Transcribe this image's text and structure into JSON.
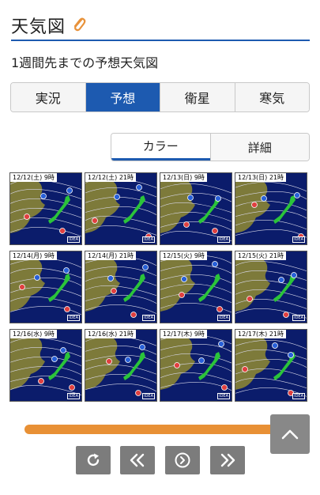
{
  "header": {
    "title": "天気図"
  },
  "subtitle": "1週間先までの予想天気図",
  "tabs": [
    {
      "label": "実況",
      "active": false
    },
    {
      "label": "予想",
      "active": true
    },
    {
      "label": "衛星",
      "active": false
    },
    {
      "label": "寒気",
      "active": false
    }
  ],
  "view_toggle": [
    {
      "label": "カラー",
      "active": true
    },
    {
      "label": "詳細",
      "active": false
    }
  ],
  "maps": [
    {
      "label": "12/12(土) 9時",
      "badge": "IDEA"
    },
    {
      "label": "12/12(土) 21時",
      "badge": "IDEA"
    },
    {
      "label": "12/13(日) 9時",
      "badge": "IDEA"
    },
    {
      "label": "12/13(日) 21時",
      "badge": "IDEA"
    },
    {
      "label": "12/14(月) 9時",
      "badge": "IDEA"
    },
    {
      "label": "12/14(月) 21時",
      "badge": "IDEA"
    },
    {
      "label": "12/15(火) 9時",
      "badge": "IDEA"
    },
    {
      "label": "12/15(火) 21時",
      "badge": "IDEA"
    },
    {
      "label": "12/16(水) 9時",
      "badge": "IDEA"
    },
    {
      "label": "12/16(水) 21時",
      "badge": "IDEA"
    },
    {
      "label": "12/17(木) 9時",
      "badge": "IDEA"
    },
    {
      "label": "12/17(木) 21時",
      "badge": "IDEA"
    }
  ],
  "colors": {
    "accent": "#1d5ab0",
    "slider": "#e89035",
    "ocean": "#0b1c6b",
    "land": "#7d7a3a",
    "japan": "#2bc43a",
    "button": "#7c7c7c"
  },
  "icons": {
    "clip": "paperclip-icon",
    "reload": "reload-icon",
    "prev": "double-chevron-left-icon",
    "play": "play-circle-icon",
    "next": "double-chevron-right-icon",
    "scroll_top": "chevron-up-icon"
  }
}
